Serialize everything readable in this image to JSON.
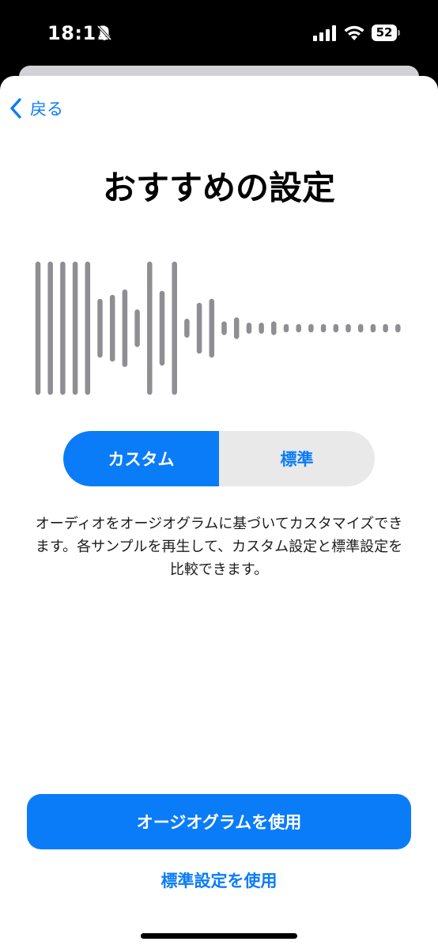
{
  "status_bar": {
    "time": "18:11",
    "battery": "52",
    "icons": [
      "bell-slash-icon",
      "cellular-signal-icon",
      "wifi-icon",
      "battery-icon"
    ]
  },
  "nav": {
    "back_label": "戻る",
    "back_icon": "chevron-left-icon"
  },
  "title": "おすすめの設定",
  "waveform": {
    "icon": "audio-waveform-icon",
    "color": "#8e8e93",
    "levels": [
      1.0,
      1.0,
      1.0,
      1.0,
      1.0,
      0.44,
      0.5,
      0.58,
      0.28,
      1.0,
      0.56,
      1.0,
      0.14,
      0.38,
      0.44,
      0.1,
      0.16,
      0.08,
      0.08,
      0.1,
      0.06,
      0.06,
      0.06,
      0.06,
      0.06,
      0.06,
      0.06,
      0.06,
      0.06,
      0.06
    ]
  },
  "segmented": {
    "options": [
      "カスタム",
      "標準"
    ],
    "selected": "カスタム"
  },
  "description": "オーディオをオージオグラムに基づいてカスタマイズできます。各サンプルを再生して、カスタム設定と標準設定を比較できます。",
  "primary_button": "オージオグラムを使用",
  "secondary_button": "標準設定を使用",
  "colors": {
    "accent": "#0a7cf8",
    "segment_background": "#e9e9ea",
    "background": "#ffffff"
  }
}
